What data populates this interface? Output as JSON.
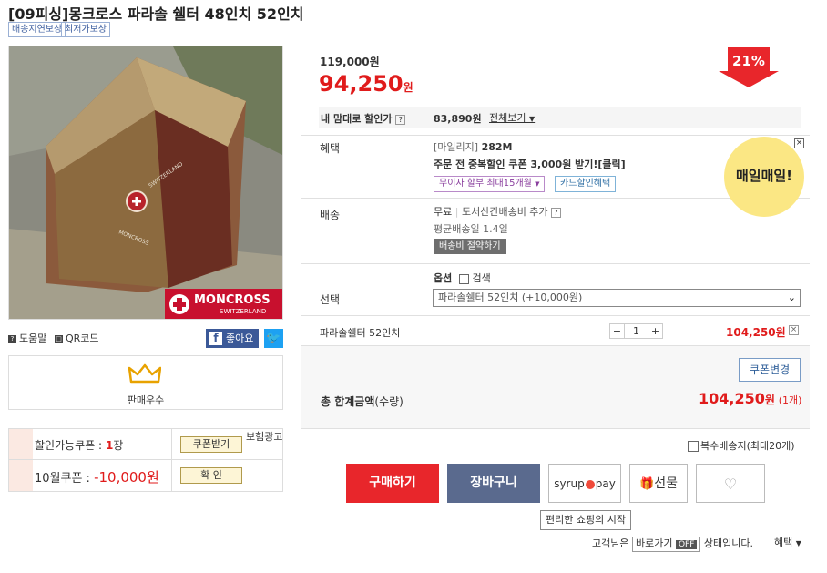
{
  "product": {
    "title": "[09피싱]몽크로스 파라솔 쉘터 48인치 52인치",
    "tags": [
      "배송지연보상",
      "최저가보상"
    ],
    "brand_logo": "MONCROSS",
    "brand_sub": "SWITZERLAND",
    "tent_print": "MONCROSS   SWITZERLAND"
  },
  "utils": {
    "help": "도움말",
    "qr": "QR코드",
    "like": "좋아요"
  },
  "seller": {
    "grade_label": "판매우수"
  },
  "coupons": {
    "available_label": "할인가능쿠폰 :",
    "available_count": "1",
    "available_unit": "장",
    "get_button": "쿠폰받기",
    "ad_label": "보험광고",
    "month_coupon_label": "10월쿠폰 :",
    "month_coupon_value": "-10,000원",
    "confirm_button": "확    인"
  },
  "price": {
    "original": "119,000원",
    "sale": "94,250",
    "sale_unit": "원",
    "discount_badge": "21%",
    "my_price_label": "내 맘대로 할인가",
    "my_price_value": "83,890원",
    "view_all": "전체보기"
  },
  "benefit": {
    "label": "혜택",
    "mileage_prefix": "[마일리지]",
    "mileage_value": "282M",
    "coupon_promo": "주문 전 중복할인 쿠폰 3,000원 받기![클릭]",
    "installment": "무이자 할부 최대15개월",
    "card_discount": "카드할인혜택",
    "ad_badge": "매일매일!"
  },
  "shipping": {
    "label": "배송",
    "fee": "무료",
    "extra": "도서산간배송비 추가",
    "avg_days": "평균배송일 1.4일",
    "save_button": "배송비 절약하기"
  },
  "option": {
    "label": "선택",
    "option_title": "옵션",
    "search_label": "검색",
    "selected": "파라솔쉘터 52인치 (+10,000원)"
  },
  "selected_item": {
    "name": "파라솔쉘터 52인치",
    "minus": "−",
    "qty": "1",
    "plus": "+",
    "price": "104,250원",
    "remove": "×"
  },
  "total": {
    "coupon_change": "쿠폰변경",
    "label": "총 합계금액",
    "label_sub": "(수량)",
    "amount": "104,250",
    "amount_unit": "원",
    "count": "(1개)"
  },
  "multi_ship": {
    "label": "복수배송지(최대20개)"
  },
  "actions": {
    "buy": "구매하기",
    "cart": "장바구니",
    "syrup": "syrup",
    "pay": "pay",
    "gift": "선물",
    "syrup_tooltip": "편리한 쇼핑의 시작"
  },
  "footer": {
    "prefix": "고객님은",
    "quick_label": "바로가기",
    "quick_state": "OFF",
    "suffix": "상태입니다.",
    "benefit": "혜택"
  },
  "colors": {
    "sale_red": "#e01b1b",
    "buy_red": "#e8262b",
    "cart_blue": "#5a6a8e",
    "ad_yellow": "#fbe784",
    "link_blue": "#3d5fa0"
  }
}
